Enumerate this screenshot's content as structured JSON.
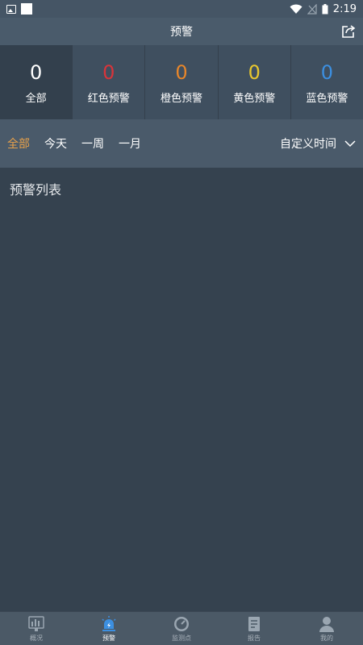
{
  "status_bar": {
    "time": "2:19"
  },
  "header": {
    "title": "预警",
    "share_icon": "share-icon"
  },
  "stats": [
    {
      "count": "0",
      "label": "全部",
      "color": "#ffffff"
    },
    {
      "count": "0",
      "label": "红色预警",
      "color": "#d8343a"
    },
    {
      "count": "0",
      "label": "橙色预警",
      "color": "#e7862a"
    },
    {
      "count": "0",
      "label": "黄色预警",
      "color": "#e8c72e"
    },
    {
      "count": "0",
      "label": "蓝色预警",
      "color": "#3c8fe0"
    }
  ],
  "filters": {
    "items": [
      "全部",
      "今天",
      "一周",
      "一月"
    ],
    "active_index": 0,
    "custom_label": "自定义时间"
  },
  "list": {
    "title": "预警列表"
  },
  "bottom_nav": [
    {
      "label": "概况",
      "icon": "dashboard-icon"
    },
    {
      "label": "预警",
      "icon": "alarm-icon"
    },
    {
      "label": "监测点",
      "icon": "gauge-icon"
    },
    {
      "label": "报告",
      "icon": "report-icon"
    },
    {
      "label": "我的",
      "icon": "user-icon"
    }
  ],
  "colors": {
    "active_filter": "#e8a14a",
    "active_nav": "#3c8fe0"
  }
}
